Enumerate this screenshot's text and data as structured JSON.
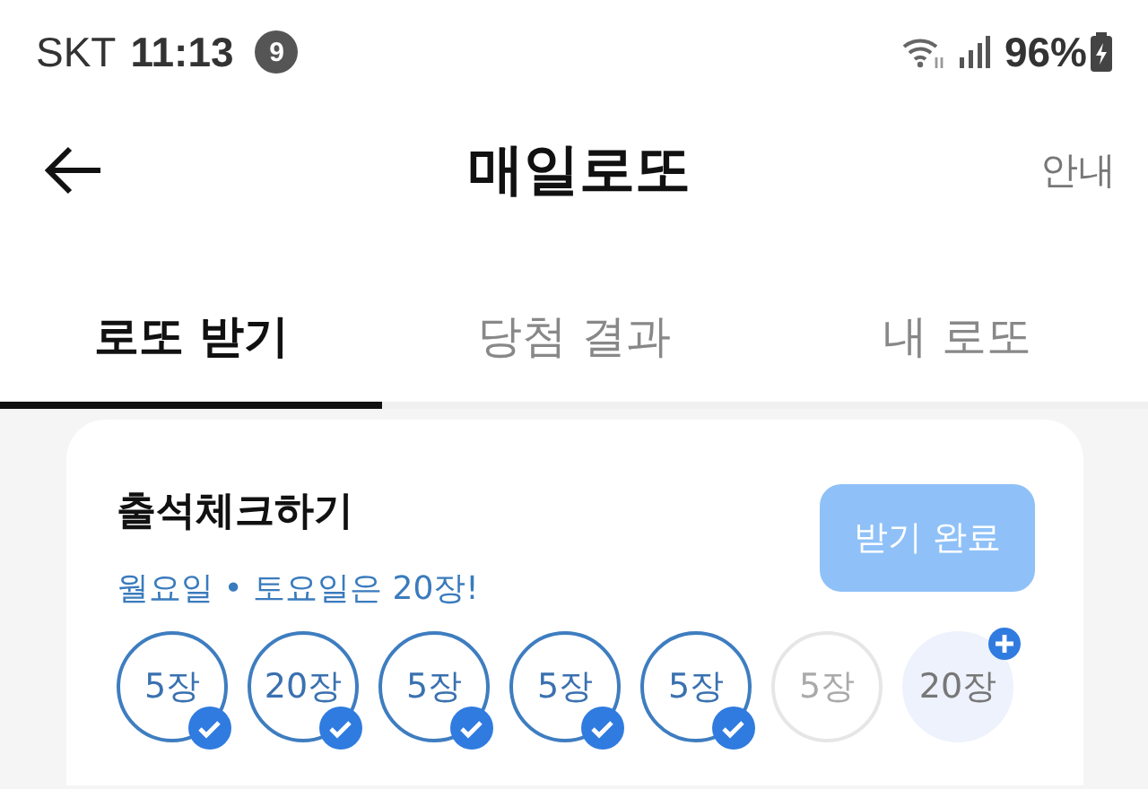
{
  "status_bar": {
    "carrier": "SKT",
    "time": "11:13",
    "notification_count": "9",
    "battery": "96%"
  },
  "header": {
    "title": "매일로또",
    "action": "안내"
  },
  "tabs": [
    {
      "label": "로또 받기",
      "selected": true
    },
    {
      "label": "당첨 결과",
      "selected": false
    },
    {
      "label": "내 로또",
      "selected": false
    }
  ],
  "attendance": {
    "title": "출석체크하기",
    "subtitle": "월요일 • 토요일은 20장!",
    "button": {
      "label": "받기 완료",
      "disabled": true
    },
    "days": [
      {
        "label": "5장",
        "kind": "done"
      },
      {
        "label": "20장",
        "kind": "done"
      },
      {
        "label": "5장",
        "kind": "done"
      },
      {
        "label": "5장",
        "kind": "done"
      },
      {
        "label": "5장",
        "kind": "done"
      },
      {
        "label": "5장",
        "kind": "upcoming"
      },
      {
        "label": "20장",
        "kind": "bonus"
      }
    ]
  }
}
